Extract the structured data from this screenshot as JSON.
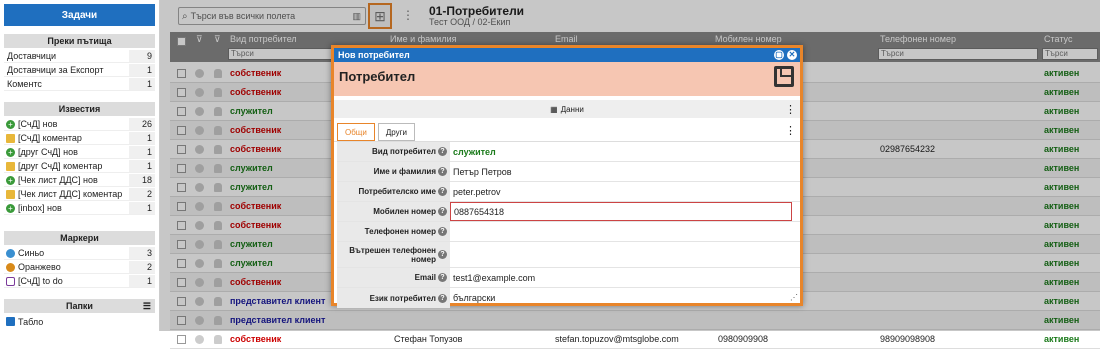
{
  "sidebar": {
    "tasks_label": "Задачи",
    "shortcuts": {
      "title": "Преки пътища",
      "items": [
        {
          "label": "Доставчици",
          "count": "9"
        },
        {
          "label": "Доставчици за Експорт",
          "count": "1"
        },
        {
          "label": "Коментс",
          "count": "1"
        }
      ]
    },
    "notifications": {
      "title": "Известия",
      "items": [
        {
          "label": "[СчД] нов",
          "count": "26",
          "icon": "plus-icon"
        },
        {
          "label": "[СчД] коментар",
          "count": "1",
          "icon": "comment-icon"
        },
        {
          "label": "[друг СчД] нов",
          "count": "1",
          "icon": "plus-icon"
        },
        {
          "label": "[друг СчД] коментар",
          "count": "1",
          "icon": "comment-icon"
        },
        {
          "label": "[Чек лист ДДС] нов",
          "count": "18",
          "icon": "plus-icon"
        },
        {
          "label": "[Чек лист ДДС] коментар",
          "count": "2",
          "icon": "comment-icon"
        },
        {
          "label": "[inbox] нов",
          "count": "1",
          "icon": "plus-icon"
        }
      ]
    },
    "markers": {
      "title": "Маркери",
      "items": [
        {
          "label": "Синьо",
          "count": "3",
          "color": "#3a8fd0"
        },
        {
          "label": "Оранжево",
          "count": "2",
          "color": "#d88a1a"
        },
        {
          "label": "[СчД] to do",
          "count": "1",
          "color": "#7a3a9a"
        }
      ]
    },
    "folders": {
      "title": "Папки",
      "items": [
        {
          "label": "Табло"
        }
      ]
    }
  },
  "topbar": {
    "search_placeholder": "Търси във всички полета",
    "title": "01-Потребители",
    "subtitle": "Тест ООД / 02-Екип"
  },
  "grid": {
    "columns": [
      "Вид потребител",
      "Име и фамилия",
      "Email",
      "Мобилен номер",
      "Телефонен номер",
      "Статус"
    ],
    "filter_placeholder": "Търси",
    "rows": [
      {
        "type": "собственик",
        "kind": "own",
        "name": "",
        "email": "",
        "mobile": "",
        "phone": "",
        "status": "активен"
      },
      {
        "type": "собственик",
        "kind": "own",
        "name": "",
        "email": "",
        "mobile": "",
        "phone": "",
        "status": "активен"
      },
      {
        "type": "служител",
        "kind": "emp",
        "name": "",
        "email": "",
        "mobile": "",
        "phone": "",
        "status": "активен"
      },
      {
        "type": "собственик",
        "kind": "own",
        "name": "",
        "email": "",
        "mobile": "",
        "phone": "",
        "status": "активен"
      },
      {
        "type": "собственик",
        "kind": "own",
        "name": "",
        "email": "",
        "mobile": "",
        "phone": "02987654232",
        "status": "активен"
      },
      {
        "type": "служител",
        "kind": "emp",
        "name": "",
        "email": "",
        "mobile": "",
        "phone": "",
        "status": "активен"
      },
      {
        "type": "служител",
        "kind": "emp",
        "name": "",
        "email": "",
        "mobile": "",
        "phone": "",
        "status": "активен"
      },
      {
        "type": "собственик",
        "kind": "own",
        "name": "",
        "email": "",
        "mobile": "",
        "phone": "",
        "status": "активен"
      },
      {
        "type": "собственик",
        "kind": "own",
        "name": "",
        "email": "",
        "mobile": "",
        "phone": "",
        "status": "активен"
      },
      {
        "type": "служител",
        "kind": "emp",
        "name": "",
        "email": "",
        "mobile": "",
        "phone": "",
        "status": "активен"
      },
      {
        "type": "служител",
        "kind": "emp",
        "name": "",
        "email": "",
        "mobile": "",
        "phone": "",
        "status": "активен"
      },
      {
        "type": "собственик",
        "kind": "own",
        "name": "",
        "email": "",
        "mobile": "",
        "phone": "",
        "status": "активен"
      },
      {
        "type": "представител клиент",
        "kind": "cli",
        "name": "",
        "email": "",
        "mobile": "",
        "phone": "",
        "status": "активен"
      },
      {
        "type": "представител клиент",
        "kind": "cli",
        "name": "",
        "email": "",
        "mobile": "",
        "phone": "",
        "status": "активен"
      },
      {
        "type": "собственик",
        "kind": "own",
        "name": "Стефан Топузов",
        "email": "stefan.topuzov@mtsglobe.com",
        "mobile": "0980909908",
        "phone": "98909098908",
        "status": "активен"
      }
    ]
  },
  "modal": {
    "window_title": "Нов потребител",
    "header": "Потребител",
    "data_bar_label": "Данни",
    "tabs": [
      "Общи",
      "Други"
    ],
    "fields": [
      {
        "label": "Вид потребител",
        "value": "служител"
      },
      {
        "label": "Име и фамилия",
        "value": "Петър Петров"
      },
      {
        "label": "Потребителско име",
        "value": "peter.petrov"
      },
      {
        "label": "Мобилен номер",
        "value": "0887654318"
      },
      {
        "label": "Телефонен номер",
        "value": ""
      },
      {
        "label": "Вътрешен телефонен номер",
        "value": ""
      },
      {
        "label": "Email",
        "value": "test1@example.com"
      },
      {
        "label": "Език потребител",
        "value": "български"
      }
    ]
  }
}
